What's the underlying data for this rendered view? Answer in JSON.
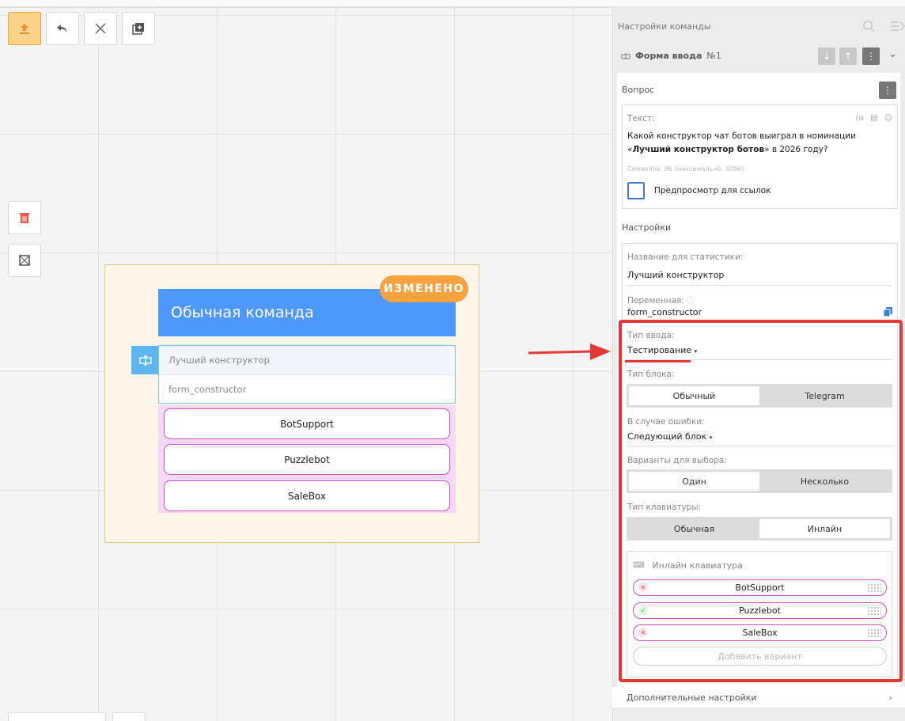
{
  "toolbar": {
    "upload_label": "upload",
    "undo_label": "undo",
    "close_label": "close",
    "copy_label": "copy",
    "delete_label": "delete",
    "frame_label": "frame"
  },
  "block": {
    "title": "Обычная команда",
    "badge": "ИЗМЕНЕНО",
    "stat_name": "Лучший конструктор",
    "variable": "form_constructor",
    "answers": [
      "BotSupport",
      "Puzzlebot",
      "SaleBox"
    ]
  },
  "panel": {
    "title": "Настройки команды",
    "command_name": "Форма ввода",
    "command_number": "№1",
    "question_section": "Вопрос",
    "text_label": "Текст:",
    "question_text_1": "Какой конструктор чат ботов выиграл в номинации «",
    "question_text_bold": "Лучший конструктор ботов",
    "question_text_2": "» в 2026 году?",
    "char_count": "Символов: 96 (максимально: 4096)",
    "preview_links": "Предпросмотр для ссылок",
    "settings_section": "Настройки",
    "stat_name_label": "Название для статистики:",
    "stat_name_value": "Лучший конструктор",
    "variable_label": "Переменная:",
    "variable_value": "form_constructor",
    "input_type_label": "Тип ввода:",
    "input_type_value": "Тестирование",
    "block_type_label": "Тип блока:",
    "block_type_options": [
      "Обычный",
      "Telegram"
    ],
    "on_error_label": "В случае ошибки:",
    "on_error_value": "Следующий блок",
    "choice_label": "Варианты для выбора:",
    "choice_options": [
      "Один",
      "Несколько"
    ],
    "keyboard_type_label": "Тип клавиатуры:",
    "keyboard_type_options": [
      "Обычная",
      "Инлайн"
    ],
    "inline_keyboard_title": "Инлайн клавиатура",
    "options": [
      {
        "label": "BotSupport",
        "status": "wrong"
      },
      {
        "label": "Puzzlebot",
        "status": "correct"
      },
      {
        "label": "SaleBox",
        "status": "wrong"
      }
    ],
    "add_option": "Добавить вариант",
    "more_settings": "Дополнительные настройки"
  },
  "colors": {
    "accent_blue": "#4f98fb",
    "badge_orange": "#f6a33d",
    "answer_border": "#d04fc9",
    "highlight_red": "#e53935"
  }
}
